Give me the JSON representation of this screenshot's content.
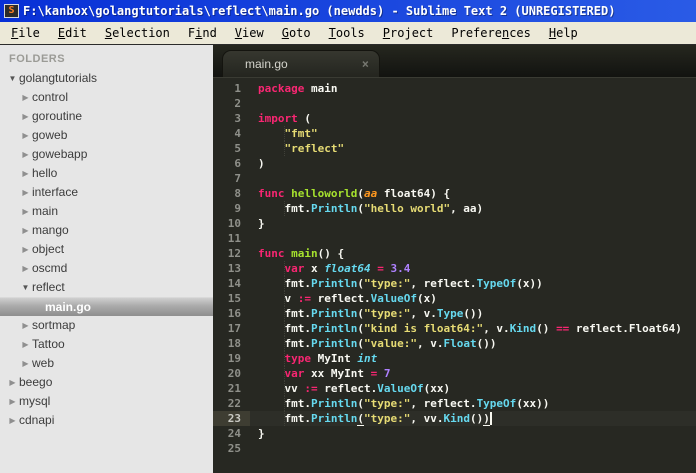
{
  "window": {
    "title": "F:\\kanbox\\golangtutorials\\reflect\\main.go (newdds) - Sublime Text 2 (UNREGISTERED)",
    "icon_letter": "S"
  },
  "menu": {
    "items": [
      {
        "label": "File",
        "u": 0
      },
      {
        "label": "Edit",
        "u": 0
      },
      {
        "label": "Selection",
        "u": 0
      },
      {
        "label": "Find",
        "u": 1
      },
      {
        "label": "View",
        "u": 0
      },
      {
        "label": "Goto",
        "u": 0
      },
      {
        "label": "Tools",
        "u": 0
      },
      {
        "label": "Project",
        "u": 0
      },
      {
        "label": "Preferences",
        "u": 7
      },
      {
        "label": "Help",
        "u": 0
      }
    ]
  },
  "sidebar": {
    "header": "FOLDERS",
    "tree": [
      {
        "label": "golangtutorials",
        "level": 0,
        "kind": "folder",
        "state": "expanded"
      },
      {
        "label": "control",
        "level": 1,
        "kind": "folder",
        "state": "collapsed"
      },
      {
        "label": "goroutine",
        "level": 1,
        "kind": "folder",
        "state": "collapsed"
      },
      {
        "label": "goweb",
        "level": 1,
        "kind": "folder",
        "state": "collapsed"
      },
      {
        "label": "gowebapp",
        "level": 1,
        "kind": "folder",
        "state": "collapsed"
      },
      {
        "label": "hello",
        "level": 1,
        "kind": "folder",
        "state": "collapsed"
      },
      {
        "label": "interface",
        "level": 1,
        "kind": "folder",
        "state": "collapsed"
      },
      {
        "label": "main",
        "level": 1,
        "kind": "folder",
        "state": "collapsed"
      },
      {
        "label": "mango",
        "level": 1,
        "kind": "folder",
        "state": "collapsed"
      },
      {
        "label": "object",
        "level": 1,
        "kind": "folder",
        "state": "collapsed"
      },
      {
        "label": "oscmd",
        "level": 1,
        "kind": "folder",
        "state": "collapsed"
      },
      {
        "label": "reflect",
        "level": 1,
        "kind": "folder",
        "state": "expanded"
      },
      {
        "label": "main.go",
        "level": 2,
        "kind": "file",
        "selected": true
      },
      {
        "label": "sortmap",
        "level": 1,
        "kind": "folder",
        "state": "collapsed"
      },
      {
        "label": "Tattoo",
        "level": 1,
        "kind": "folder",
        "state": "collapsed"
      },
      {
        "label": "web",
        "level": 1,
        "kind": "folder",
        "state": "collapsed"
      },
      {
        "label": "beego",
        "level": 0,
        "kind": "folder",
        "state": "collapsed"
      },
      {
        "label": "mysql",
        "level": 0,
        "kind": "folder",
        "state": "collapsed"
      },
      {
        "label": "cdnapi",
        "level": 0,
        "kind": "folder",
        "state": "collapsed"
      }
    ]
  },
  "editor": {
    "tab": {
      "label": "main.go",
      "close_glyph": "×"
    },
    "current_line": 23,
    "total_lines": 25,
    "colors": {
      "background": "#272822",
      "foreground": "#f8f8f2",
      "keyword": "#f92672",
      "function_def": "#a6e22e",
      "function_call": "#66d9ef",
      "type": "#66d9ef",
      "string": "#e6db74",
      "number": "#ae81ff",
      "parameter": "#fd971f",
      "gutter": "#8f908a",
      "current_line_gutter_bg": "#3e3d32",
      "titlebar_blue": "#0830d6",
      "menubar_beige": "#ece9d8",
      "sidebar_gray": "#e6e6e6"
    },
    "lines": [
      {
        "num": 1,
        "ind": 0,
        "spans": [
          [
            "k",
            "package"
          ],
          [
            "f",
            " main"
          ]
        ]
      },
      {
        "num": 2,
        "ind": 0,
        "spans": []
      },
      {
        "num": 3,
        "ind": 0,
        "spans": [
          [
            "k",
            "import"
          ],
          [
            "f",
            " ("
          ]
        ]
      },
      {
        "num": 4,
        "ind": 1,
        "spans": [
          [
            "f",
            "    "
          ],
          [
            "s",
            "\"fmt\""
          ]
        ]
      },
      {
        "num": 5,
        "ind": 1,
        "spans": [
          [
            "f",
            "    "
          ],
          [
            "s",
            "\"reflect\""
          ]
        ]
      },
      {
        "num": 6,
        "ind": 0,
        "spans": [
          [
            "f",
            ")"
          ]
        ]
      },
      {
        "num": 7,
        "ind": 0,
        "spans": []
      },
      {
        "num": 8,
        "ind": 0,
        "spans": [
          [
            "k",
            "func"
          ],
          [
            "f",
            " "
          ],
          [
            "fn",
            "helloworld"
          ],
          [
            "f",
            "("
          ],
          [
            "p",
            "aa"
          ],
          [
            "f",
            " float64) {"
          ]
        ]
      },
      {
        "num": 9,
        "ind": 1,
        "spans": [
          [
            "f",
            "    fmt."
          ],
          [
            "c",
            "Println"
          ],
          [
            "f",
            "("
          ],
          [
            "s",
            "\"hello world\""
          ],
          [
            "f",
            ", aa)"
          ]
        ]
      },
      {
        "num": 10,
        "ind": 0,
        "spans": [
          [
            "f",
            "}"
          ]
        ]
      },
      {
        "num": 11,
        "ind": 0,
        "spans": []
      },
      {
        "num": 12,
        "ind": 0,
        "spans": [
          [
            "k",
            "func"
          ],
          [
            "f",
            " "
          ],
          [
            "fn",
            "main"
          ],
          [
            "f",
            "() {"
          ]
        ]
      },
      {
        "num": 13,
        "ind": 1,
        "spans": [
          [
            "f",
            "    "
          ],
          [
            "k",
            "var"
          ],
          [
            "f",
            " x "
          ],
          [
            "ty",
            "float64"
          ],
          [
            "f",
            " "
          ],
          [
            "k",
            "="
          ],
          [
            "f",
            " "
          ],
          [
            "n",
            "3.4"
          ]
        ]
      },
      {
        "num": 14,
        "ind": 1,
        "spans": [
          [
            "f",
            "    fmt."
          ],
          [
            "c",
            "Println"
          ],
          [
            "f",
            "("
          ],
          [
            "s",
            "\"type:\""
          ],
          [
            "f",
            ", reflect."
          ],
          [
            "c",
            "TypeOf"
          ],
          [
            "f",
            "(x))"
          ]
        ]
      },
      {
        "num": 15,
        "ind": 1,
        "spans": [
          [
            "f",
            "    v "
          ],
          [
            "k",
            ":="
          ],
          [
            "f",
            " reflect."
          ],
          [
            "c",
            "ValueOf"
          ],
          [
            "f",
            "(x)"
          ]
        ]
      },
      {
        "num": 16,
        "ind": 1,
        "spans": [
          [
            "f",
            "    fmt."
          ],
          [
            "c",
            "Println"
          ],
          [
            "f",
            "("
          ],
          [
            "s",
            "\"type:\""
          ],
          [
            "f",
            ", v."
          ],
          [
            "c",
            "Type"
          ],
          [
            "f",
            "())"
          ]
        ]
      },
      {
        "num": 17,
        "ind": 1,
        "spans": [
          [
            "f",
            "    fmt."
          ],
          [
            "c",
            "Println"
          ],
          [
            "f",
            "("
          ],
          [
            "s",
            "\"kind is float64:\""
          ],
          [
            "f",
            ", v."
          ],
          [
            "c",
            "Kind"
          ],
          [
            "f",
            "() "
          ],
          [
            "k",
            "=="
          ],
          [
            "f",
            " reflect.Float64)"
          ]
        ]
      },
      {
        "num": 18,
        "ind": 1,
        "spans": [
          [
            "f",
            "    fmt."
          ],
          [
            "c",
            "Println"
          ],
          [
            "f",
            "("
          ],
          [
            "s",
            "\"value:\""
          ],
          [
            "f",
            ", v."
          ],
          [
            "c",
            "Float"
          ],
          [
            "f",
            "())"
          ]
        ]
      },
      {
        "num": 19,
        "ind": 1,
        "spans": [
          [
            "f",
            "    "
          ],
          [
            "k",
            "type"
          ],
          [
            "f",
            " MyInt "
          ],
          [
            "ty",
            "int"
          ]
        ]
      },
      {
        "num": 20,
        "ind": 1,
        "spans": [
          [
            "f",
            "    "
          ],
          [
            "k",
            "var"
          ],
          [
            "f",
            " xx MyInt "
          ],
          [
            "k",
            "="
          ],
          [
            "f",
            " "
          ],
          [
            "n",
            "7"
          ]
        ]
      },
      {
        "num": 21,
        "ind": 1,
        "spans": [
          [
            "f",
            "    vv "
          ],
          [
            "k",
            ":="
          ],
          [
            "f",
            " reflect."
          ],
          [
            "c",
            "ValueOf"
          ],
          [
            "f",
            "(xx)"
          ]
        ]
      },
      {
        "num": 22,
        "ind": 1,
        "spans": [
          [
            "f",
            "    fmt."
          ],
          [
            "c",
            "Println"
          ],
          [
            "f",
            "("
          ],
          [
            "s",
            "\"type:\""
          ],
          [
            "f",
            ", reflect."
          ],
          [
            "c",
            "TypeOf"
          ],
          [
            "f",
            "(xx))"
          ]
        ]
      },
      {
        "num": 23,
        "ind": 1,
        "spans": [
          [
            "f",
            "    fmt."
          ],
          [
            "c",
            "Println"
          ],
          [
            "u",
            "("
          ],
          [
            "s",
            "\"type:\""
          ],
          [
            "f",
            ", vv."
          ],
          [
            "c",
            "Kind"
          ],
          [
            "f",
            "()"
          ],
          [
            "u",
            ")"
          ],
          [
            "caret",
            ""
          ]
        ]
      },
      {
        "num": 24,
        "ind": 0,
        "spans": [
          [
            "f",
            "}"
          ]
        ]
      },
      {
        "num": 25,
        "ind": 0,
        "spans": []
      }
    ]
  }
}
